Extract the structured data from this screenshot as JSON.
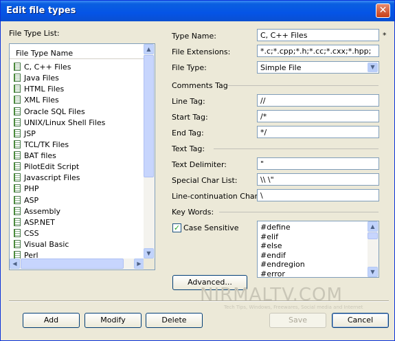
{
  "window": {
    "title": "Edit file types"
  },
  "left": {
    "list_title": "File Type List:",
    "column_header": "File Type Name",
    "items": [
      "C, C++ Files",
      "Java Files",
      "HTML Files",
      "XML Files",
      "Oracle SQL Files",
      "UNIX/Linux Shell Files",
      "JSP",
      "TCL/TK Files",
      "BAT files",
      "PilotEdit Script",
      "Javascript Files",
      "PHP",
      "ASP",
      "Assembly",
      "ASP.NET",
      "CSS",
      "Visual Basic",
      "Perl"
    ]
  },
  "fields": {
    "type_name_label": "Type Name:",
    "type_name_value": "C, C++ Files",
    "required_mark": "*",
    "extensions_label": "File Extensions:",
    "extensions_value": "*.c;*.cpp;*.h;*.cc;*.cxx;*.hpp;",
    "file_type_label": "File Type:",
    "file_type_value": "Simple File",
    "comments_section": "Comments Tag",
    "line_tag_label": "Line Tag:",
    "line_tag_value": "//",
    "start_tag_label": "Start Tag:",
    "start_tag_value": "/*",
    "end_tag_label": "End Tag:",
    "end_tag_value": "*/",
    "text_section": "Text Tag:",
    "text_delimiter_label": "Text Delimiter:",
    "text_delimiter_value": "\"",
    "special_char_label": "Special Char List:",
    "special_char_value": "\\\\ \\\"",
    "line_cont_label": "Line-continuation Char:",
    "line_cont_value": "\\",
    "keywords_section": "Key Words:",
    "case_sensitive_label": "Case Sensitive",
    "case_sensitive_checked": true,
    "keywords": [
      "#define",
      "#elif",
      "#else",
      "#endif",
      "#endregion",
      "#error"
    ]
  },
  "buttons": {
    "advanced": "Advanced...",
    "add": "Add",
    "modify": "Modify",
    "delete": "Delete",
    "save": "Save",
    "cancel": "Cancel"
  },
  "watermark": {
    "main": "NIRMALTV.COM",
    "sub": "Tech Tips, Windows, Freewares, Social media and Internet"
  }
}
